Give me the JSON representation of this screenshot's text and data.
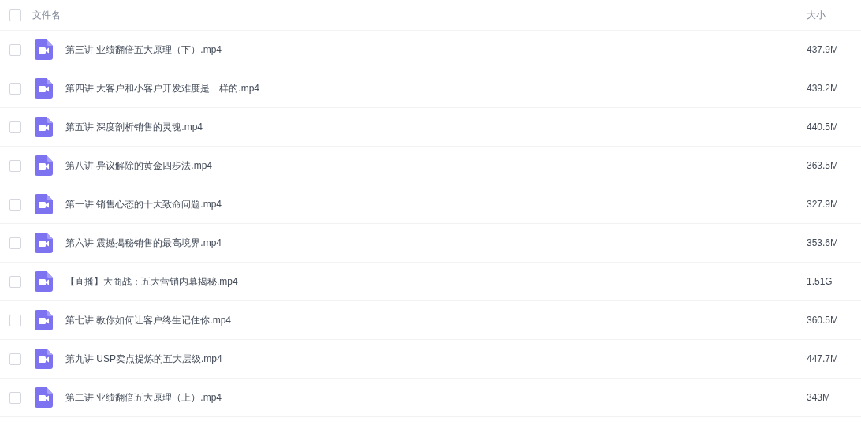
{
  "header": {
    "checked": false,
    "name_column": "文件名",
    "size_column": "大小"
  },
  "files": [
    {
      "name": "第三讲 业绩翻倍五大原理（下）.mp4",
      "size": "437.9M",
      "checked": false
    },
    {
      "name": "第四讲 大客户和小客户开发难度是一样的.mp4",
      "size": "439.2M",
      "checked": false
    },
    {
      "name": "第五讲 深度剖析销售的灵魂.mp4",
      "size": "440.5M",
      "checked": false
    },
    {
      "name": "第八讲 异议解除的黄金四步法.mp4",
      "size": "363.5M",
      "checked": false
    },
    {
      "name": "第一讲 销售心态的十大致命问题.mp4",
      "size": "327.9M",
      "checked": false
    },
    {
      "name": "第六讲 震撼揭秘销售的最高境界.mp4",
      "size": "353.6M",
      "checked": false
    },
    {
      "name": "【直播】大商战：五大营销内幕揭秘.mp4",
      "size": "1.51G",
      "checked": false
    },
    {
      "name": "第七讲 教你如何让客户终生记住你.mp4",
      "size": "360.5M",
      "checked": false
    },
    {
      "name": "第九讲 USP卖点提炼的五大层级.mp4",
      "size": "447.7M",
      "checked": false
    },
    {
      "name": "第二讲 业绩翻倍五大原理（上）.mp4",
      "size": "343M",
      "checked": false
    }
  ]
}
